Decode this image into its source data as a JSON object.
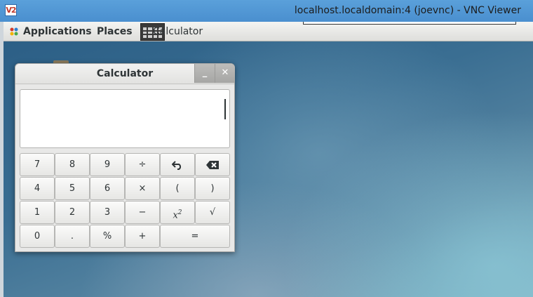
{
  "vnc": {
    "logo": "V2",
    "title": "localhost.localdomain:4 (joevnc) - VNC Viewer"
  },
  "panel": {
    "applications_label": "Applications",
    "places_label": "Places",
    "active_app_label": "Calculator"
  },
  "calculator": {
    "title": "Calculator",
    "minimize_label": "_",
    "close_label": "✕",
    "display_value": "",
    "keys": {
      "k7": "7",
      "k8": "8",
      "k9": "9",
      "divide": "÷",
      "undo": "↶",
      "backspace": "⌫",
      "k4": "4",
      "k5": "5",
      "k6": "6",
      "multiply": "×",
      "lparen": "(",
      "rparen": ")",
      "k1": "1",
      "k2": "2",
      "k3": "3",
      "subtract": "−",
      "square_base": "x",
      "square_exp": "2",
      "sqrt": "√",
      "k0": "0",
      "decimal": ".",
      "percent": "%",
      "add": "+",
      "equals": "="
    }
  },
  "colors": {
    "vnc_titlebar": "#4a8fcf",
    "panel": "#e8e8e6",
    "desktop": "#3a6e92"
  }
}
